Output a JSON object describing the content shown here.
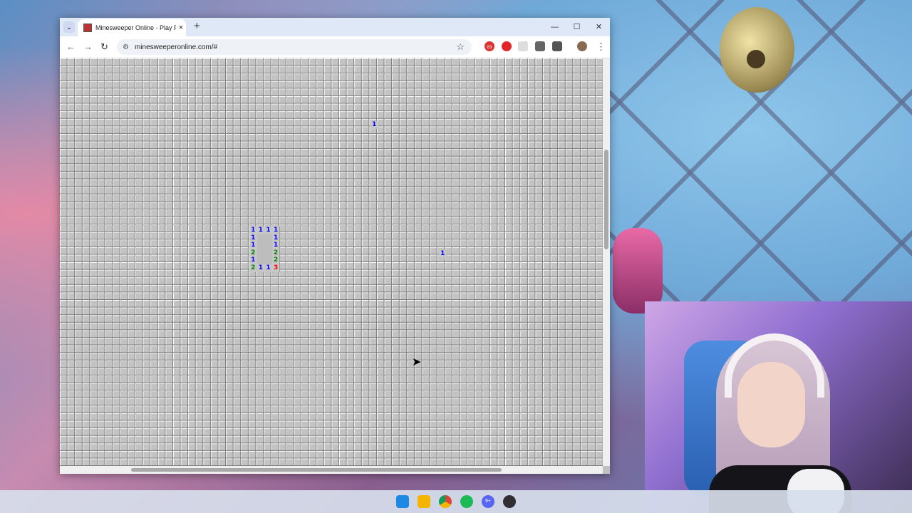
{
  "browser": {
    "tab_title": "Minesweeper Online - Play Free Online Minesweeper",
    "tab_close": "×",
    "tab_dropdown": "⌄",
    "new_tab": "+",
    "window_controls": {
      "minimize": "—",
      "maximize": "☐",
      "close": "✕"
    },
    "nav": {
      "back": "←",
      "forward": "→",
      "reload": "↻"
    },
    "url": "minesweeperonline.com/#",
    "site_icon": "⚙",
    "bookmark_star": "☆",
    "extension_badge": "83",
    "menu": "⋮"
  },
  "game": {
    "cells": [
      {
        "row": 0,
        "col": 0,
        "v": "1",
        "c": "#0000ff"
      },
      {
        "row": 0,
        "col": 1,
        "v": "1",
        "c": "#0000ff"
      },
      {
        "row": 0,
        "col": 2,
        "v": "1",
        "c": "#0000ff"
      },
      {
        "row": 0,
        "col": 3,
        "v": "1",
        "c": "#0000ff"
      },
      {
        "row": 1,
        "col": 0,
        "v": "1",
        "c": "#0000ff"
      },
      {
        "row": 1,
        "col": 3,
        "v": "1",
        "c": "#0000ff"
      },
      {
        "row": 2,
        "col": 0,
        "v": "1",
        "c": "#0000ff"
      },
      {
        "row": 2,
        "col": 3,
        "v": "1",
        "c": "#0000ff"
      },
      {
        "row": 3,
        "col": 0,
        "v": "2",
        "c": "#008000"
      },
      {
        "row": 3,
        "col": 3,
        "v": "2",
        "c": "#008000"
      },
      {
        "row": 4,
        "col": 0,
        "v": "1",
        "c": "#0000ff"
      },
      {
        "row": 4,
        "col": 3,
        "v": "2",
        "c": "#008000"
      },
      {
        "row": 5,
        "col": 0,
        "v": "2",
        "c": "#008000"
      },
      {
        "row": 5,
        "col": 1,
        "v": "1",
        "c": "#0000ff"
      },
      {
        "row": 5,
        "col": 2,
        "v": "1",
        "c": "#0000ff"
      },
      {
        "row": 5,
        "col": 3,
        "v": "3",
        "c": "#ff0000"
      }
    ],
    "lone_cells": [
      {
        "v": "1",
        "c": "#0000ff"
      },
      {
        "v": "1",
        "c": "#0000ff"
      }
    ]
  },
  "taskbar": {
    "icons": [
      "windows-start-icon",
      "file-explorer-icon",
      "chrome-icon",
      "spotify-icon",
      "discord-icon",
      "obs-icon"
    ],
    "discord_badge": "9+"
  },
  "cursor": "➤"
}
